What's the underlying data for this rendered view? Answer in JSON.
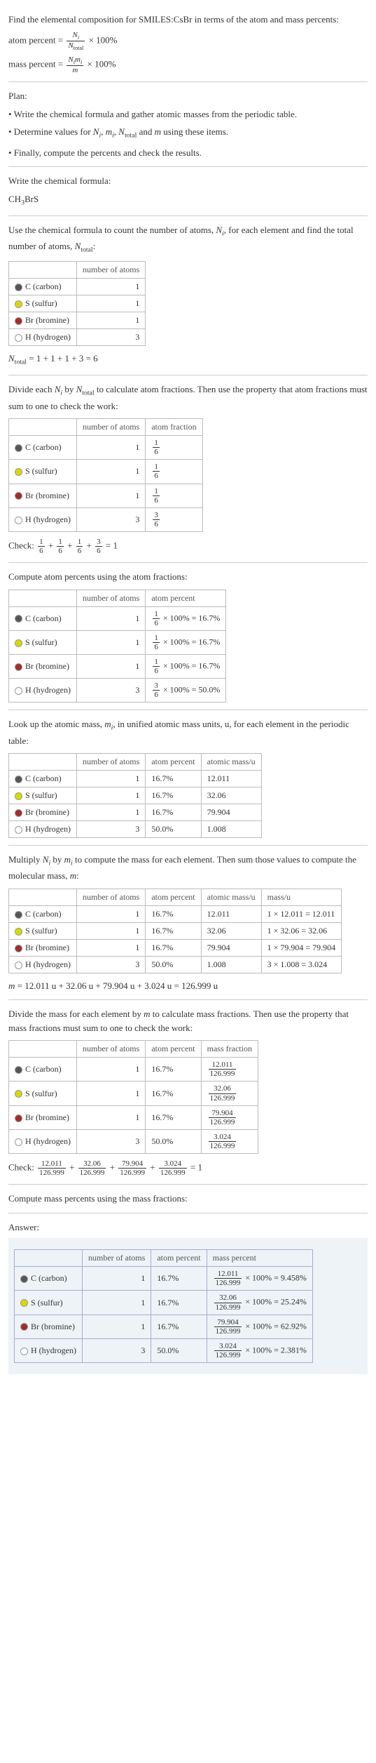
{
  "title": "Find the elemental composition for SMILES:CsBr in terms of the atom and mass percents:",
  "def_atom_percent_lhs": "atom percent = ",
  "def_atom_frac_num": "N_i",
  "def_atom_frac_den": "N_total",
  "def_times100": " × 100%",
  "def_mass_percent_lhs": "mass percent = ",
  "def_mass_frac_num": "N_i m_i",
  "def_mass_frac_den": "m",
  "plan_label": "Plan:",
  "plan1": "• Write the chemical formula and gather atomic masses from the periodic table.",
  "plan2_a": "• Determine values for ",
  "plan2_b": " using these items.",
  "plan3": "• Finally, compute the percents and check the results.",
  "write_formula_label": "Write the chemical formula:",
  "formula": "CH₃BrS",
  "count_intro_a": "Use the chemical formula to count the number of atoms, ",
  "count_intro_b": ", for each element and find the total number of atoms, ",
  "count_intro_c": ":",
  "hdr_number_of_atoms": "number of atoms",
  "hdr_atom_fraction": "atom fraction",
  "hdr_atom_percent": "atom percent",
  "hdr_atomic_mass": "atomic mass/u",
  "hdr_mass_u": "mass/u",
  "hdr_mass_fraction": "mass fraction",
  "hdr_mass_percent": "mass percent",
  "elements": [
    {
      "key": "c",
      "name": "C (carbon)",
      "n": "1",
      "frac_num": "1",
      "frac_den": "6",
      "pct": "16.7%",
      "amass": "12.011",
      "mass_calc": "1 × 12.011 = 12.011",
      "mf_num": "12.011",
      "mf_den": "126.999",
      "mpct": "9.458%"
    },
    {
      "key": "s",
      "name": "S (sulfur)",
      "n": "1",
      "frac_num": "1",
      "frac_den": "6",
      "pct": "16.7%",
      "amass": "32.06",
      "mass_calc": "1 × 32.06 = 32.06",
      "mf_num": "32.06",
      "mf_den": "126.999",
      "mpct": "25.24%"
    },
    {
      "key": "br",
      "name": "Br (bromine)",
      "n": "1",
      "frac_num": "1",
      "frac_den": "6",
      "pct": "16.7%",
      "amass": "79.904",
      "mass_calc": "1 × 79.904 = 79.904",
      "mf_num": "79.904",
      "mf_den": "126.999",
      "mpct": "62.92%"
    },
    {
      "key": "h",
      "name": "H (hydrogen)",
      "n": "3",
      "frac_num": "3",
      "frac_den": "6",
      "pct": "50.0%",
      "amass": "1.008",
      "mass_calc": "3 × 1.008 = 3.024",
      "mf_num": "3.024",
      "mf_den": "126.999",
      "mpct": "2.381%"
    }
  ],
  "ntotal_eq": " = 1 + 1 + 1 + 3 = 6",
  "divide_intro_a": "Divide each ",
  "divide_intro_b": " by ",
  "divide_intro_c": " to calculate atom fractions. Then use the property that atom fractions must sum to one to check the work:",
  "check_label": "Check: ",
  "check_sum_eq": " = 1",
  "compute_atom_pct": "Compute atom percents using the atom fractions:",
  "pct_times100": " × 100% = ",
  "lookup_intro_a": "Look up the atomic mass, ",
  "lookup_intro_b": ", in unified atomic mass units, u, for each element in the periodic table:",
  "multiply_intro_a": "Multiply ",
  "multiply_intro_b": " by ",
  "multiply_intro_c": " to compute the mass for each element. Then sum those values to compute the molecular mass, ",
  "multiply_intro_d": ":",
  "m_eq": " = 12.011 u + 32.06 u + 79.904 u + 3.024 u = 126.999 u",
  "divide_mass_intro_a": "Divide the mass for each element by ",
  "divide_mass_intro_b": " to calculate mass fractions. Then use the property that mass fractions must sum to one to check the work:",
  "compute_mass_pct": "Compute mass percents using the mass fractions:",
  "answer_label": "Answer:",
  "sym_Ni": "N",
  "sym_i": "i",
  "sym_Ntotal": "N",
  "sym_total": "total",
  "sym_mi": "m",
  "sym_m": "m",
  "plus": " + ",
  "comma": ", ",
  "and": " and "
}
